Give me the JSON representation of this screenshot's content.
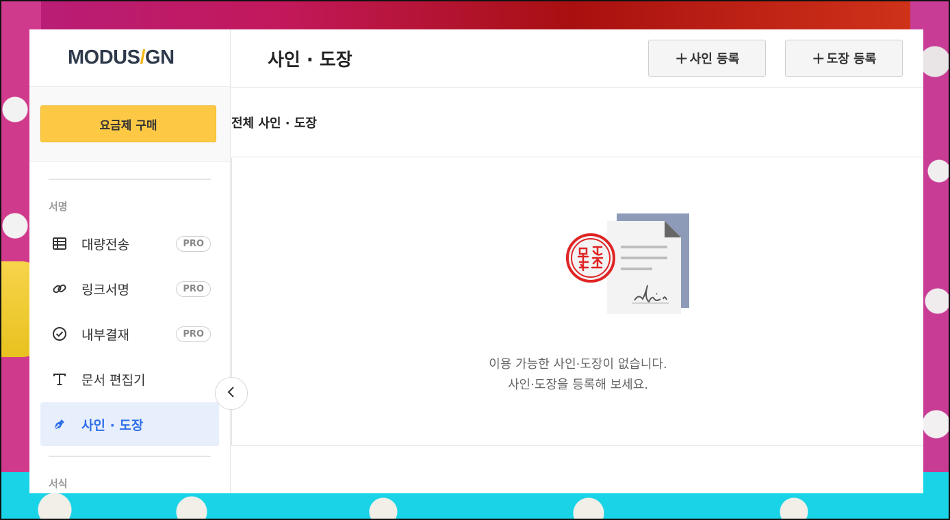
{
  "app": {
    "logo_left": "MODUS",
    "logo_slash": "/",
    "logo_right": "GN"
  },
  "sidebar": {
    "buy_label": "요금제 구매",
    "section_sign": "서명",
    "section_forms": "서식",
    "items": [
      {
        "label": "대량전송",
        "badge": "PRO",
        "icon": "table-icon"
      },
      {
        "label": "링크서명",
        "badge": "PRO",
        "icon": "link-icon"
      },
      {
        "label": "내부결재",
        "badge": "PRO",
        "icon": "check-circle-icon"
      },
      {
        "label": "문서 편집기",
        "badge": "",
        "icon": "text-icon"
      },
      {
        "label": "사인 · 도장",
        "badge": "",
        "icon": "pen-nib-icon",
        "active": true
      }
    ]
  },
  "header": {
    "title": "사인 · 도장",
    "add_sign_label": "사인 등록",
    "add_stamp_label": "도장 등록",
    "plus": "+"
  },
  "main": {
    "section_title": "전체 사인 · 도장",
    "empty_line1": "이용 가능한 사인·도장이 없습니다.",
    "empty_line2": "사인·도장을 등록해 보세요."
  },
  "colors": {
    "brand_navy": "#2e3a4b",
    "brand_yellow": "#f5b616",
    "buy_button": "#fdc945",
    "active_blue": "#2f6ee8",
    "active_bg": "#e8effc",
    "stamp_red": "#e02424"
  }
}
